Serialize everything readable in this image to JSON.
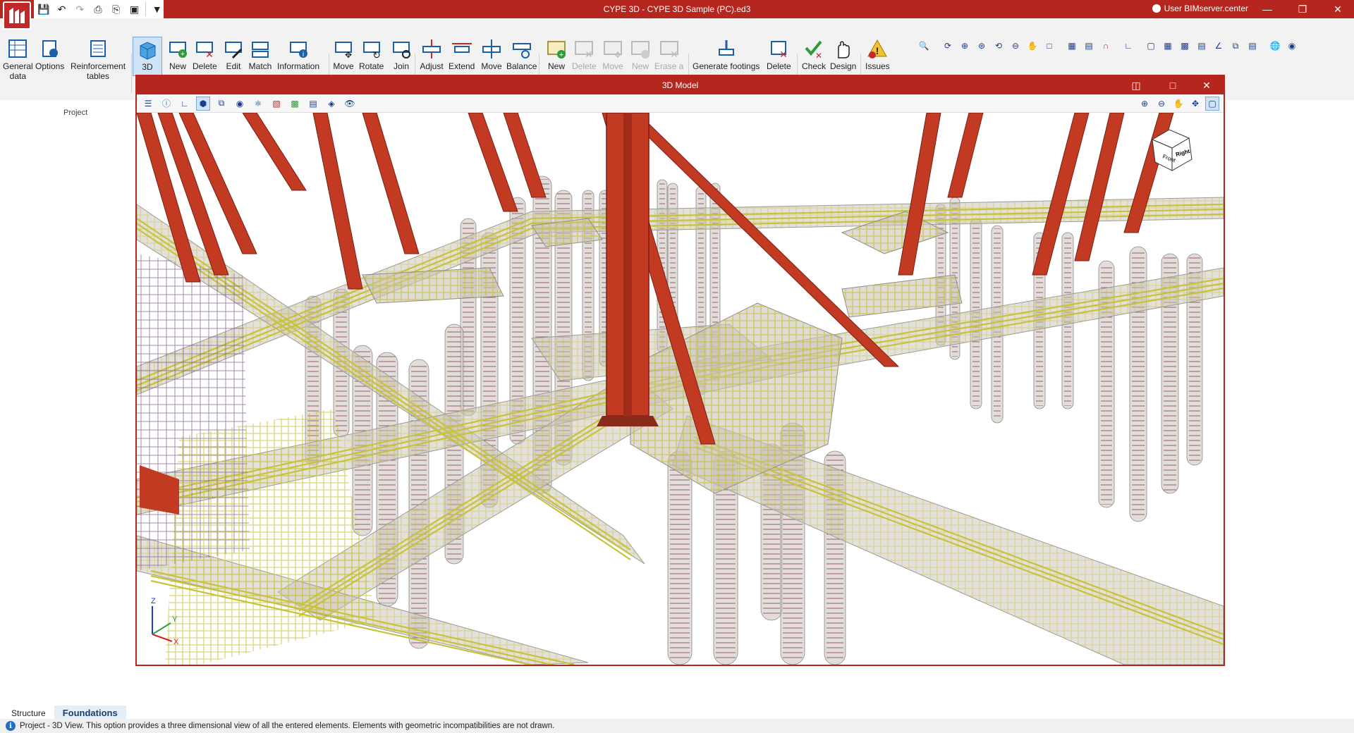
{
  "window": {
    "title": "CYPE 3D - CYPE 3D Sample (PC).ed3",
    "user": "User BIMserver.center"
  },
  "ribbon": {
    "project_group_label": "Project",
    "buttons": {
      "general_data": "General\ndata",
      "options": "Options",
      "reinforcement_tables": "Reinforcement\ntables",
      "view_3d": "3D",
      "new_1": "New",
      "delete_1": "Delete",
      "edit": "Edit",
      "match": "Match",
      "information": "Information",
      "move_1": "Move",
      "rotate": "Rotate",
      "join": "Join",
      "adjust": "Adjust",
      "extend": "Extend",
      "move_2": "Move",
      "balance": "Balance",
      "new_2": "New",
      "delete_2": "Delete",
      "move_3": "Move",
      "new_3": "New",
      "erase_a": "Erase a",
      "generate_footings": "Generate footings",
      "delete_3": "Delete",
      "check": "Check",
      "design": "Design",
      "issues": "Issues"
    }
  },
  "model_window": {
    "title": "3D Model",
    "viewcube": {
      "front": "Front",
      "right": "Right"
    },
    "axes": {
      "x": "X",
      "y": "Y",
      "z": "Z"
    }
  },
  "tabs": {
    "structure": "Structure",
    "foundations": "Foundations"
  },
  "status": {
    "text": "Project - 3D View. This option provides a three dimensional view of all the entered elements. Elements with geometric incompatibilities are not drawn."
  },
  "colors": {
    "accent": "#b5261e",
    "steel": "#c23a22",
    "rebar": "#c8c23a",
    "concrete": "#c9c3bb"
  }
}
